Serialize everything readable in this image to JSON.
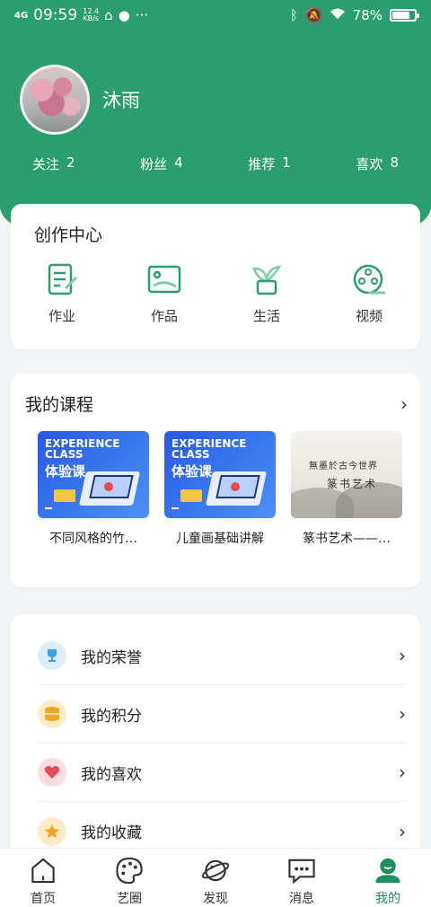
{
  "status_bar": {
    "signal": "4G",
    "time": "09:59",
    "speed_value": "12.4",
    "speed_unit": "KB/s",
    "extra": "···",
    "battery_percent": "78%",
    "battery_level": 0.78
  },
  "profile": {
    "username": "沐雨"
  },
  "stats": [
    {
      "label": "关注",
      "value": "2"
    },
    {
      "label": "粉丝",
      "value": "4"
    },
    {
      "label": "推荐",
      "value": "1"
    },
    {
      "label": "喜欢",
      "value": "8"
    }
  ],
  "create_center": {
    "title": "创作中心",
    "items": [
      {
        "label": "作业",
        "icon": "homework-icon"
      },
      {
        "label": "作品",
        "icon": "artwork-icon"
      },
      {
        "label": "生活",
        "icon": "plant-icon"
      },
      {
        "label": "视频",
        "icon": "video-reel-icon"
      }
    ]
  },
  "courses": {
    "title": "我的课程",
    "more": "›",
    "items": [
      {
        "name": "不同风格的竹…",
        "thumb_line1": "EXPERIENCE",
        "thumb_line2": "CLASS",
        "thumb_line3": "体验课"
      },
      {
        "name": "儿童画基础讲解",
        "thumb_line1": "EXPERIENCE",
        "thumb_line2": "CLASS",
        "thumb_line3": "体验课"
      },
      {
        "name": "篆书艺术——…",
        "thumb_text1": "無墨於古今世界",
        "thumb_text2": "篆书艺术"
      }
    ]
  },
  "menu": {
    "items": [
      {
        "label": "我的荣誉",
        "icon": "trophy-icon",
        "color": "#3aa2e6",
        "bg": "#dceefb"
      },
      {
        "label": "我的积分",
        "icon": "coins-icon",
        "color": "#f2a521",
        "bg": "#fdebc8"
      },
      {
        "label": "我的喜欢",
        "icon": "heart-icon",
        "color": "#e84a5a",
        "bg": "#fcdcdf"
      },
      {
        "label": "我的收藏",
        "icon": "star-icon",
        "color": "#f2a521",
        "bg": "#fdebc8"
      }
    ],
    "chevron": "›"
  },
  "tabbar": {
    "tabs": [
      {
        "label": "首页",
        "icon": "home-icon",
        "active": false
      },
      {
        "label": "艺圈",
        "icon": "palette-icon",
        "active": false
      },
      {
        "label": "发现",
        "icon": "planet-icon",
        "active": false
      },
      {
        "label": "消息",
        "icon": "message-icon",
        "active": false
      },
      {
        "label": "我的",
        "icon": "profile-icon",
        "active": true
      }
    ]
  },
  "colors": {
    "brand": "#2a9e6e",
    "active_tab": "#1f8f5c"
  }
}
